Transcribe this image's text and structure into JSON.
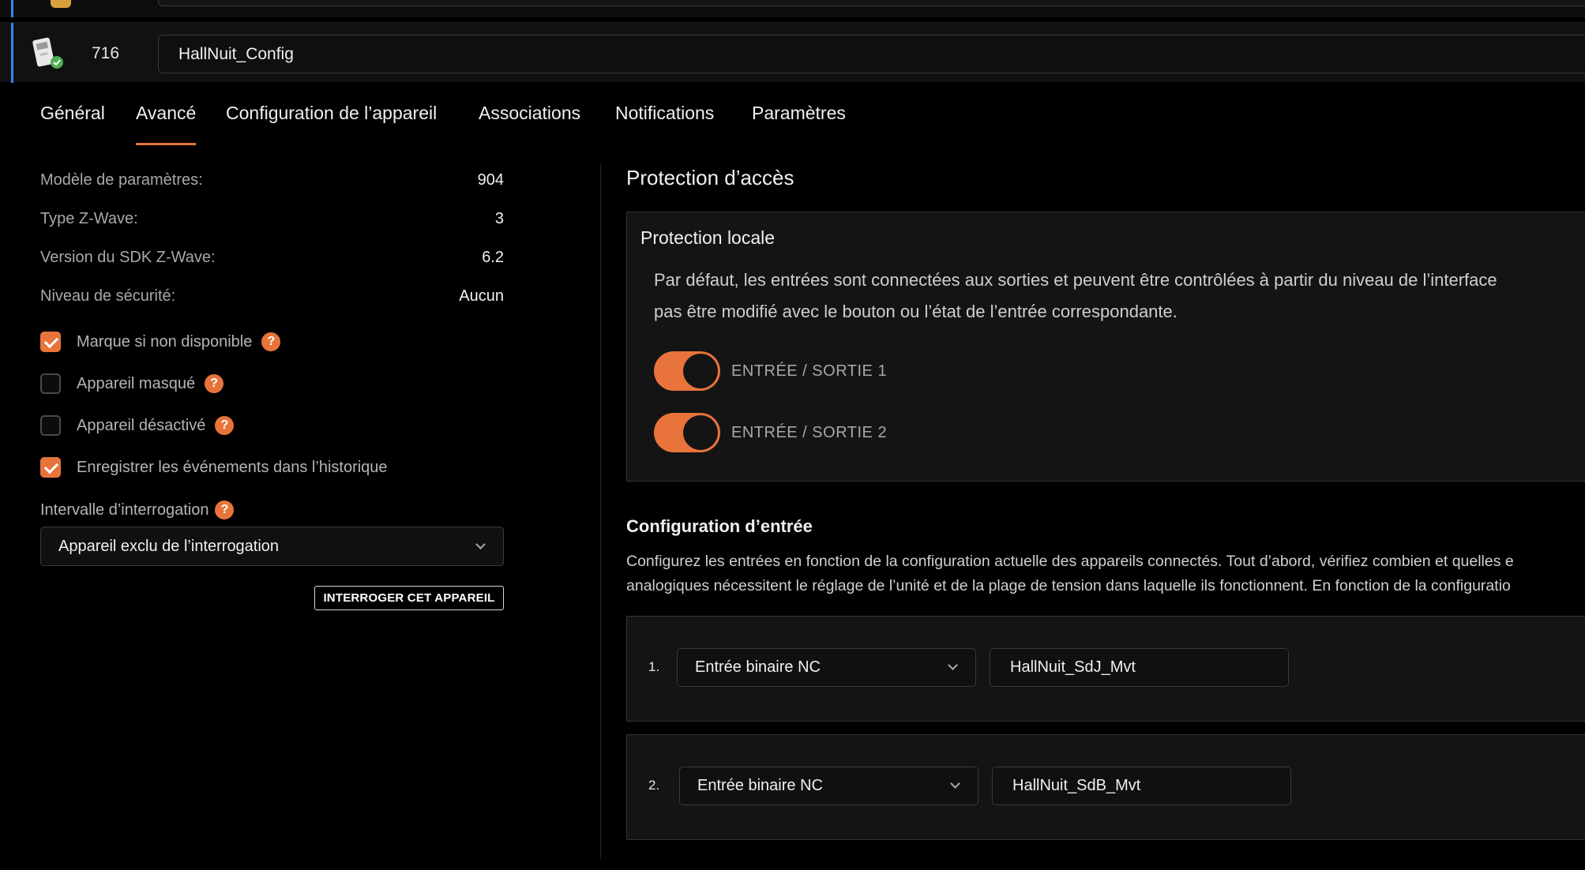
{
  "device": {
    "id": "716",
    "name": "HallNuit_Config",
    "icon": "zwave-module-icon",
    "status_icon": "online-check-icon"
  },
  "tabs": [
    {
      "label": "Général",
      "active": false
    },
    {
      "label": "Avancé",
      "active": true
    },
    {
      "label": "Configuration de l’appareil",
      "active": false
    },
    {
      "label": "Associations",
      "active": false
    },
    {
      "label": "Notifications",
      "active": false
    },
    {
      "label": "Paramètres",
      "active": false
    }
  ],
  "info": [
    {
      "key": "Modèle de paramètres:",
      "value": "904"
    },
    {
      "key": "Type Z-Wave:",
      "value": "3"
    },
    {
      "key": "Version du SDK Z-Wave:",
      "value": "6.2"
    },
    {
      "key": "Niveau de sécurité:",
      "value": "Aucun"
    }
  ],
  "options": [
    {
      "label": "Marque si non disponible",
      "checked": true,
      "help": "?"
    },
    {
      "label": "Appareil masqué",
      "checked": false,
      "help": "?"
    },
    {
      "label": "Appareil désactivé",
      "checked": false,
      "help": "?"
    },
    {
      "label": "Enregistrer les événements dans l’historique",
      "checked": true
    }
  ],
  "polling": {
    "label": "Intervalle d’interrogation",
    "help": "?",
    "selected": "Appareil exclu de l’interrogation",
    "button": "INTERROGER CET APPAREIL"
  },
  "access_protection": {
    "title": "Protection d’accès",
    "local": {
      "title": "Protection locale",
      "description_line1": "Par défaut, les entrées sont connectées aux sorties et peuvent être contrôlées à partir du niveau de l’interface",
      "description_line2": "pas être modifié avec le bouton ou l’état de l’entrée correspondante.",
      "toggles": [
        {
          "label": "ENTRÉE / SORTIE 1",
          "on": true
        },
        {
          "label": "ENTRÉE / SORTIE 2",
          "on": true
        }
      ]
    }
  },
  "input_config": {
    "title": "Configuration d’entrée",
    "description_line1": "Configurez les entrées en fonction de la configuration actuelle des appareils connectés. Tout d’abord, vérifiez combien et quelles e",
    "description_line2": "analogiques nécessitent le réglage de l’unité et de la plage de tension dans laquelle ils fonctionnent. En fonction de la configuratio",
    "inputs": [
      {
        "num": "1.",
        "type": "Entrée binaire NC",
        "name": "HallNuit_SdJ_Mvt"
      },
      {
        "num": "2.",
        "type": "Entrée binaire NC",
        "name": "HallNuit_SdB_Mvt"
      }
    ]
  },
  "colors": {
    "accent": "#e8743b",
    "row_marker": "#3b82f6",
    "background": "#000000",
    "card": "#141414"
  }
}
